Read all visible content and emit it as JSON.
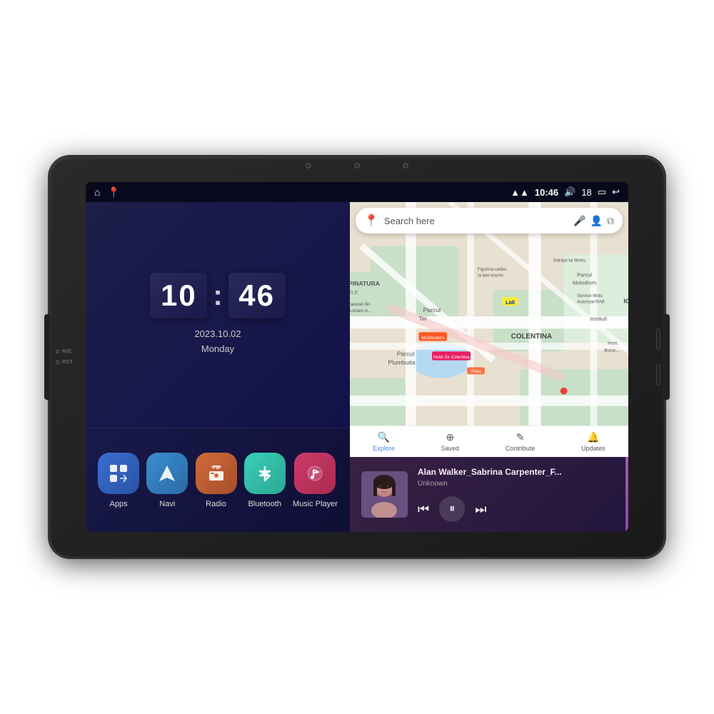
{
  "device": {
    "side_labels": [
      "MIC",
      "RST"
    ]
  },
  "status_bar": {
    "time": "10:46",
    "volume": "18",
    "icons": {
      "wifi": "📶",
      "volume": "🔊",
      "battery": "🔋",
      "back": "↩"
    }
  },
  "clock": {
    "hour": "10",
    "minute": "46",
    "date": "2023.10.02",
    "day": "Monday"
  },
  "map": {
    "search_placeholder": "Search here",
    "places": [
      "APINATURA",
      "APICOLE",
      "COLENTINA",
      "Lidl",
      "McDonald's",
      "Hotel Sir Colentina"
    ],
    "nav_items": [
      {
        "label": "Explore",
        "active": true
      },
      {
        "label": "Saved",
        "active": false
      },
      {
        "label": "Contribute",
        "active": false
      },
      {
        "label": "Updates",
        "active": false
      }
    ]
  },
  "shortcuts": [
    {
      "label": "Apps",
      "icon": "⊞",
      "color_class": "icon-apps"
    },
    {
      "label": "Navi",
      "icon": "▲",
      "color_class": "icon-navi"
    },
    {
      "label": "Radio",
      "icon": "📻",
      "color_class": "icon-radio"
    },
    {
      "label": "Bluetooth",
      "icon": "𝔅",
      "color_class": "icon-bluetooth"
    },
    {
      "label": "Music Player",
      "icon": "♪",
      "color_class": "icon-music"
    }
  ],
  "music_player": {
    "title": "Alan Walker_Sabrina Carpenter_F...",
    "artist": "Unknown",
    "controls": {
      "prev": "⏮",
      "play": "⏸",
      "next": "⏭"
    }
  }
}
